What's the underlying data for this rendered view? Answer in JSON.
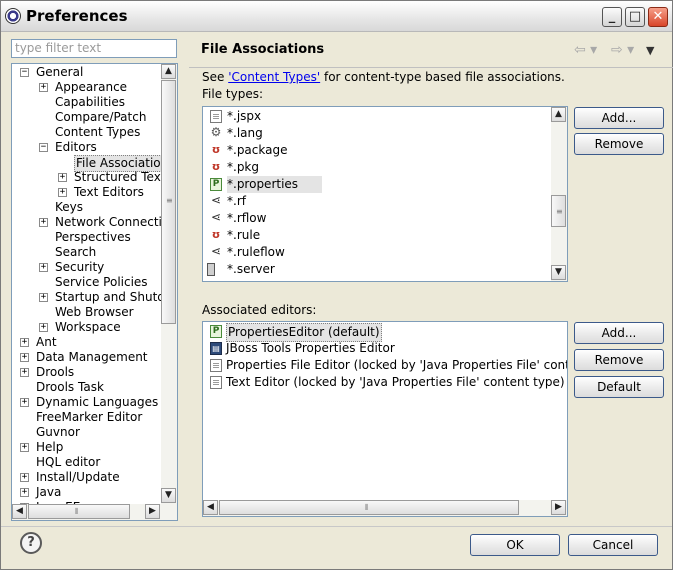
{
  "window": {
    "title": "Preferences",
    "min": "_",
    "max": "□",
    "close": "✕"
  },
  "filter": {
    "placeholder": "type filter text"
  },
  "tree": {
    "items": [
      {
        "label": "General",
        "toggle": "−"
      },
      {
        "label": "Appearance",
        "toggle": "+"
      },
      {
        "label": "Capabilities",
        "toggle": ""
      },
      {
        "label": "Compare/Patch",
        "toggle": ""
      },
      {
        "label": "Content Types",
        "toggle": ""
      },
      {
        "label": "Editors",
        "toggle": "−"
      },
      {
        "label": "File Associations",
        "toggle": ""
      },
      {
        "label": "Structured Text Editors",
        "toggle": "+"
      },
      {
        "label": "Text Editors",
        "toggle": "+"
      },
      {
        "label": "Keys",
        "toggle": ""
      },
      {
        "label": "Network Connections",
        "toggle": "+"
      },
      {
        "label": "Perspectives",
        "toggle": ""
      },
      {
        "label": "Search",
        "toggle": ""
      },
      {
        "label": "Security",
        "toggle": "+"
      },
      {
        "label": "Service Policies",
        "toggle": ""
      },
      {
        "label": "Startup and Shutdown",
        "toggle": "+"
      },
      {
        "label": "Web Browser",
        "toggle": ""
      },
      {
        "label": "Workspace",
        "toggle": "+"
      },
      {
        "label": "Ant",
        "toggle": "+"
      },
      {
        "label": "Data Management",
        "toggle": "+"
      },
      {
        "label": "Drools",
        "toggle": "+"
      },
      {
        "label": "Drools Task",
        "toggle": ""
      },
      {
        "label": "Dynamic Languages",
        "toggle": "+"
      },
      {
        "label": "FreeMarker Editor",
        "toggle": ""
      },
      {
        "label": "Guvnor",
        "toggle": ""
      },
      {
        "label": "Help",
        "toggle": "+"
      },
      {
        "label": "HQL editor",
        "toggle": ""
      },
      {
        "label": "Install/Update",
        "toggle": "+"
      },
      {
        "label": "Java",
        "toggle": "+"
      },
      {
        "label": "Java EE",
        "toggle": "+"
      }
    ]
  },
  "page": {
    "title": "File Associations",
    "back": "⇦ ▾",
    "forward": "⇨ ▾",
    "menu": "▼",
    "info_prefix": "See ",
    "info_link": "'Content Types'",
    "info_suffix": " for content-type based file associations.",
    "file_types_label": "File types:",
    "assoc_label": "Associated editors:"
  },
  "file_types": [
    {
      "label": "*.jspx",
      "icon": "doc-icon"
    },
    {
      "label": "*.lang",
      "icon": "gear-icon"
    },
    {
      "label": "*.package",
      "icon": "drools-icon"
    },
    {
      "label": "*.pkg",
      "icon": "drools-icon"
    },
    {
      "label": "*.properties",
      "icon": "properties-icon"
    },
    {
      "label": "*.rf",
      "icon": "flow-icon"
    },
    {
      "label": "*.rflow",
      "icon": "flow-icon"
    },
    {
      "label": "*.rule",
      "icon": "drools-icon"
    },
    {
      "label": "*.ruleflow",
      "icon": "flow-icon"
    },
    {
      "label": "*.server",
      "icon": "server-icon"
    }
  ],
  "editors": [
    {
      "label": "PropertiesEditor (default)",
      "icon": "properties-icon"
    },
    {
      "label": "JBoss Tools Properties Editor",
      "icon": "jboss-icon"
    },
    {
      "label": "Properties File Editor (locked by 'Java Properties File' content type)",
      "icon": "doc-icon"
    },
    {
      "label": "Text Editor (locked by 'Java Properties File' content type)",
      "icon": "doc-icon"
    }
  ],
  "buttons": {
    "add_type": "Add...",
    "remove_type": "Remove",
    "add_editor": "Add...",
    "remove_editor": "Remove",
    "default": "Default",
    "ok": "OK",
    "cancel": "Cancel",
    "help": "?"
  }
}
